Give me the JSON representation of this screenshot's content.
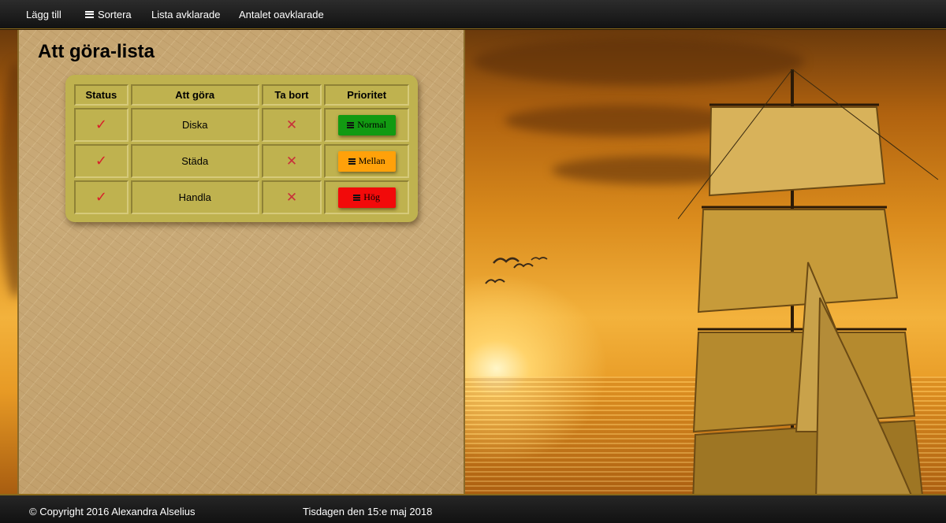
{
  "nav": {
    "add_label": "Lägg till",
    "sort_label": "Sortera",
    "done_list_label": "Lista avklarade",
    "undone_count_label": "Antalet oavklarade"
  },
  "page": {
    "title": "Att göra-lista"
  },
  "table": {
    "headers": {
      "status": "Status",
      "todo": "Att göra",
      "delete": "Ta bort",
      "priority": "Prioritet"
    },
    "rows": [
      {
        "status_icon": "check-icon",
        "task": "Diska",
        "delete_icon": "cross-icon",
        "priority": "Normal",
        "priority_color": "#129a12"
      },
      {
        "status_icon": "check-icon",
        "task": "Städa",
        "delete_icon": "cross-icon",
        "priority": "Mellan",
        "priority_color": "#ffa10a"
      },
      {
        "status_icon": "check-icon",
        "task": "Handla",
        "delete_icon": "cross-icon",
        "priority": "Hög",
        "priority_color": "#f20a0a"
      }
    ]
  },
  "glyphs": {
    "check": "✓",
    "cross": "✕"
  },
  "footer": {
    "copyright": "© Copyright 2016 Alexandra Alselius",
    "date": "Tisdagen den 15:e maj 2018"
  }
}
